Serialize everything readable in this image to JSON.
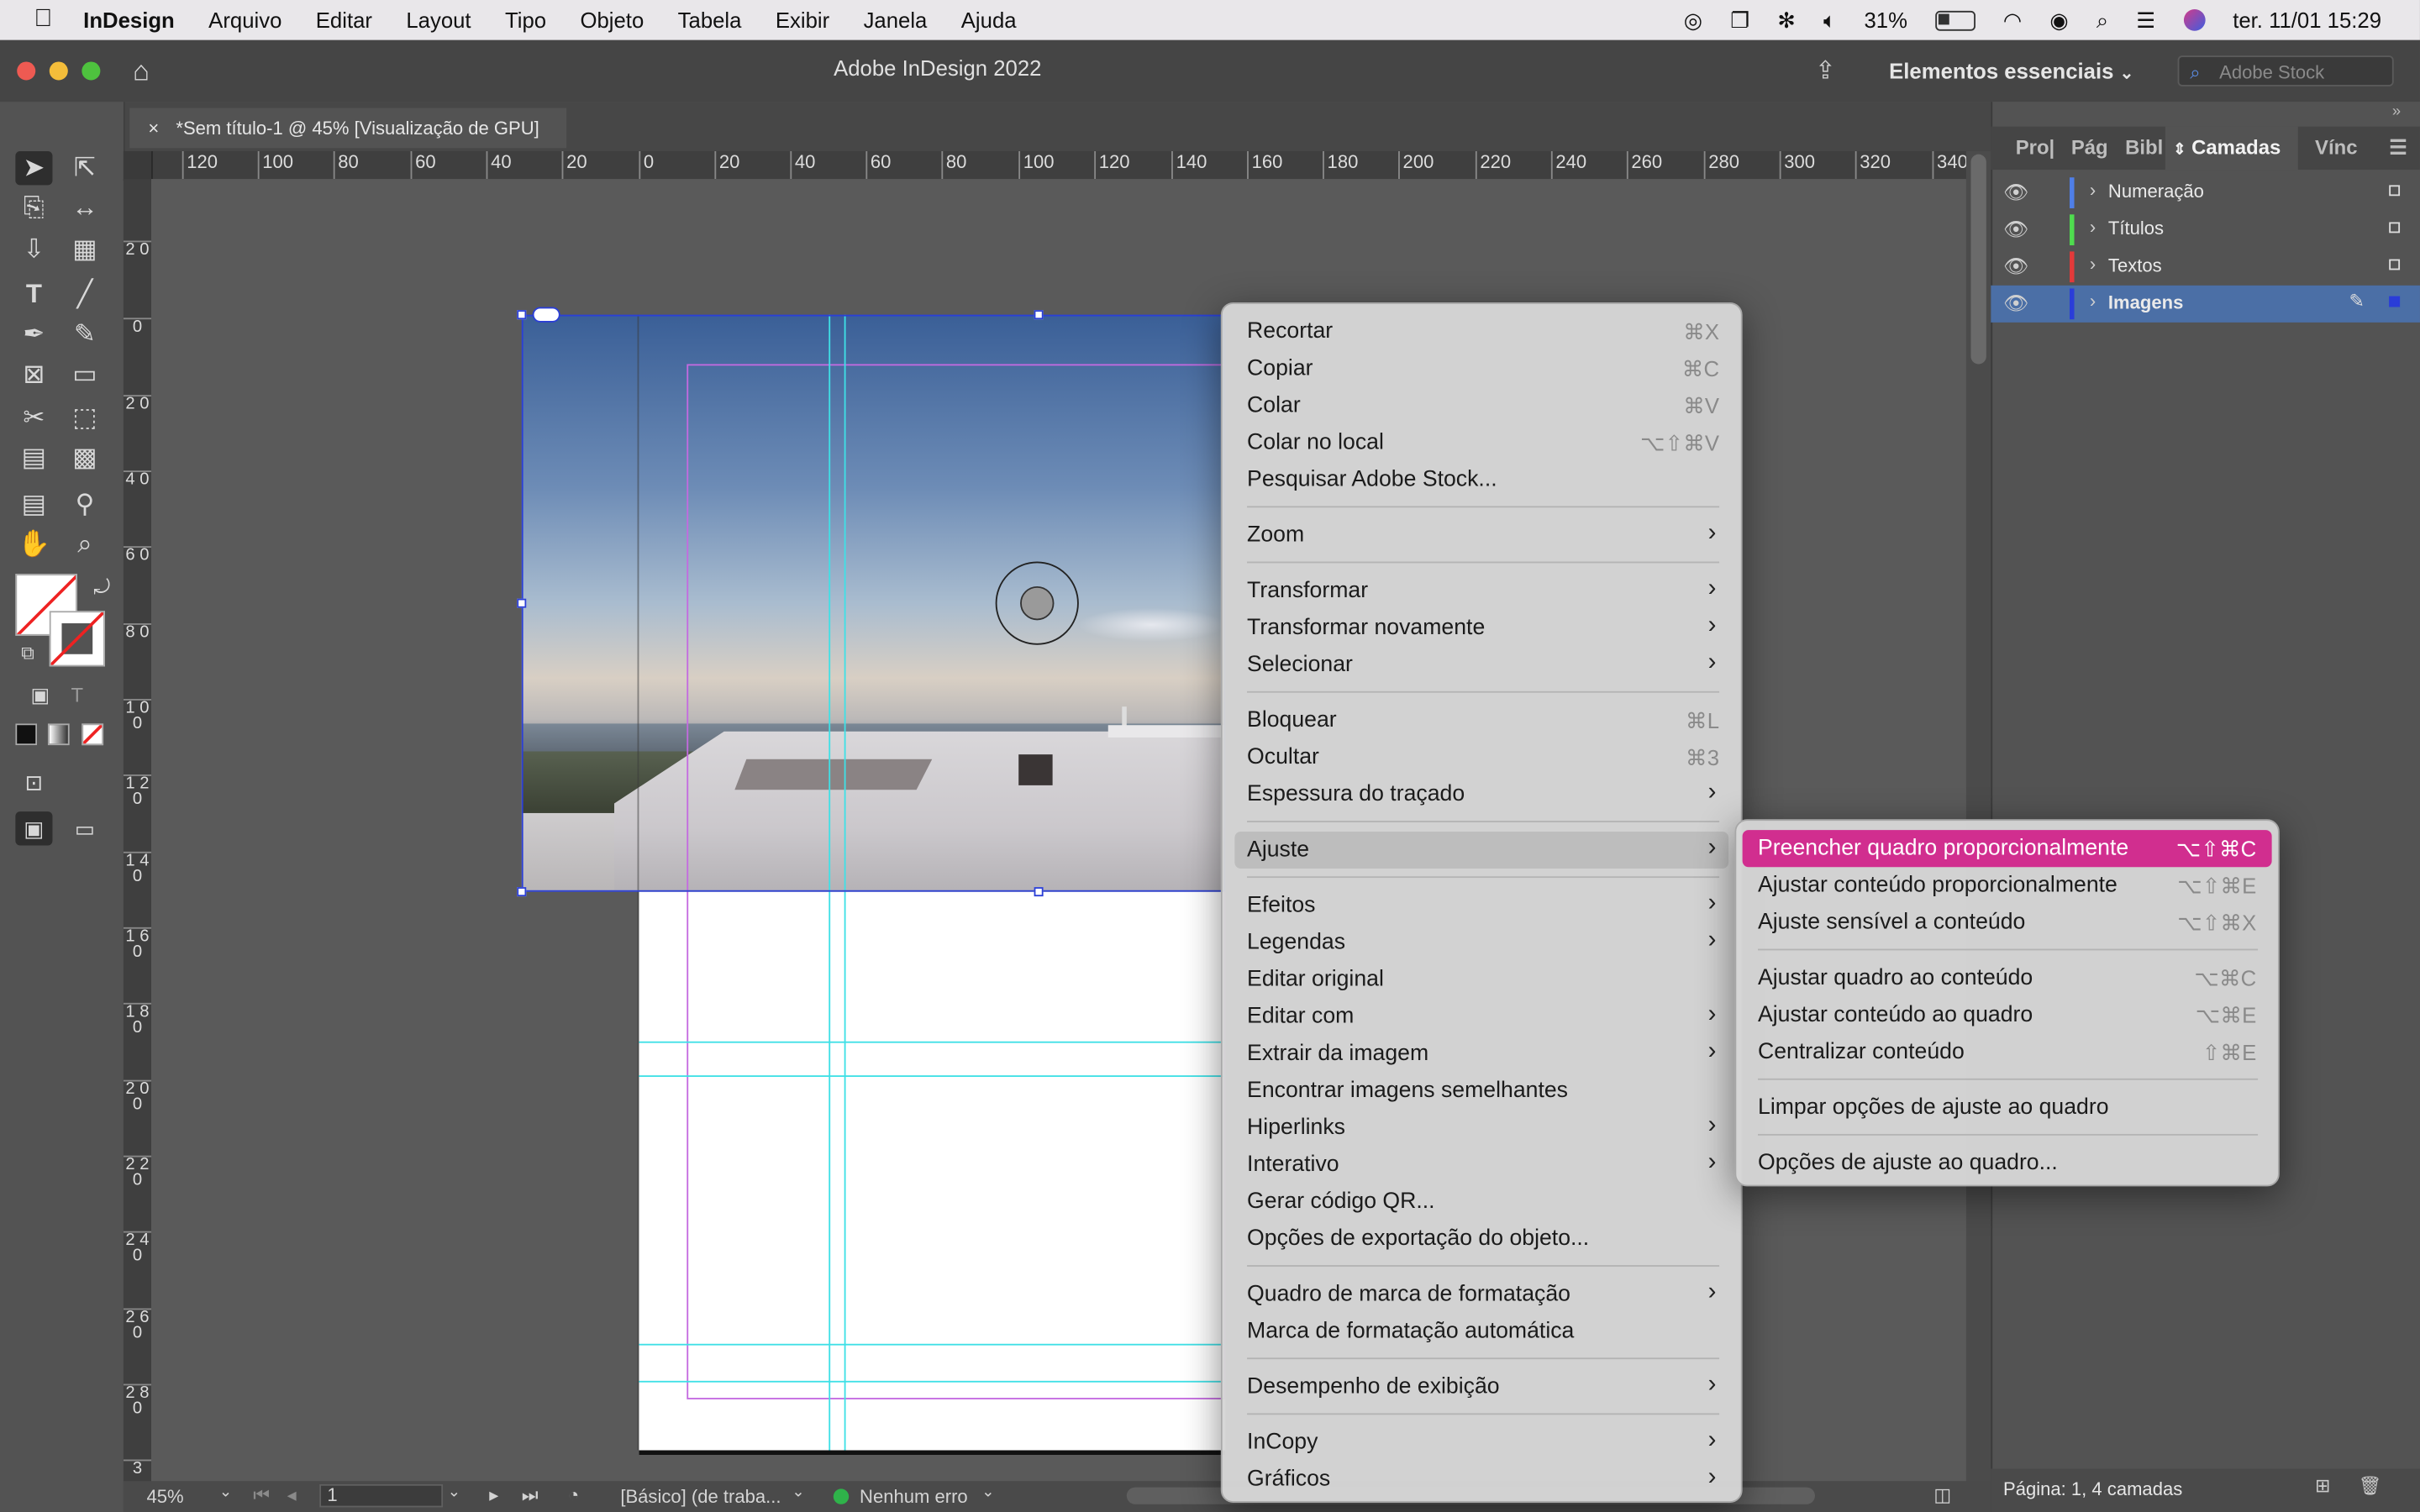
{
  "menubar": {
    "apple_icon": "apple-logo-icon",
    "app_name": "InDesign",
    "items": [
      "Arquivo",
      "Editar",
      "Layout",
      "Tipo",
      "Objeto",
      "Tabela",
      "Exibir",
      "Janela",
      "Ajuda"
    ],
    "battery": "31%",
    "datetime": "ter. 11/01  15:29"
  },
  "window": {
    "title": "Adobe InDesign 2022",
    "workspace": "Elementos essenciais",
    "stock_placeholder": "Adobe Stock"
  },
  "document_tab": {
    "close": "×",
    "label": "*Sem título-1 @ 45% [Visualização de GPU]"
  },
  "ruler": {
    "horizontal": [
      "120",
      "100",
      "80",
      "60",
      "40",
      "20",
      "0",
      "20",
      "40",
      "60",
      "80",
      "100",
      "120",
      "140",
      "160",
      "180",
      "200",
      "220",
      "240",
      "260",
      "280",
      "300",
      "320",
      "340"
    ],
    "vertical": [
      "2 0",
      "0",
      "2 0",
      "4 0",
      "6 0",
      "8 0",
      "1 0 0",
      "1 2 0",
      "1 4 0",
      "1 6 0",
      "1 8 0",
      "2 0 0",
      "2 2 0",
      "2 4 0",
      "2 6 0",
      "2 8 0",
      "3"
    ]
  },
  "context_menu": {
    "items": [
      {
        "label": "Recortar",
        "shortcut": "⌘X"
      },
      {
        "label": "Copiar",
        "shortcut": "⌘C"
      },
      {
        "label": "Colar",
        "shortcut": "⌘V"
      },
      {
        "label": "Colar no local",
        "shortcut": "⌥⇧⌘V"
      },
      {
        "label": "Pesquisar Adobe Stock...",
        "shortcut": ""
      },
      {
        "label": "Zoom",
        "shortcut": ""
      },
      {
        "label": "Transformar",
        "shortcut": ""
      },
      {
        "label": "Transformar novamente",
        "shortcut": ""
      },
      {
        "label": "Selecionar",
        "shortcut": ""
      },
      {
        "label": "Bloquear",
        "shortcut": "⌘L"
      },
      {
        "label": "Ocultar",
        "shortcut": "⌘3"
      },
      {
        "label": "Espessura do traçado",
        "shortcut": ""
      },
      {
        "label": "Ajuste",
        "shortcut": ""
      },
      {
        "label": "Efeitos",
        "shortcut": ""
      },
      {
        "label": "Legendas",
        "shortcut": ""
      },
      {
        "label": "Editar original",
        "shortcut": ""
      },
      {
        "label": "Editar com",
        "shortcut": ""
      },
      {
        "label": "Extrair da imagem",
        "shortcut": ""
      },
      {
        "label": "Encontrar imagens semelhantes",
        "shortcut": ""
      },
      {
        "label": "Hiperlinks",
        "shortcut": ""
      },
      {
        "label": "Interativo",
        "shortcut": ""
      },
      {
        "label": "Gerar código QR...",
        "shortcut": ""
      },
      {
        "label": "Opções de exportação do objeto...",
        "shortcut": ""
      },
      {
        "label": "Quadro de marca de formatação",
        "shortcut": ""
      },
      {
        "label": "Marca de formatação automática",
        "shortcut": ""
      },
      {
        "label": "Desempenho de exibição",
        "shortcut": ""
      },
      {
        "label": "InCopy",
        "shortcut": ""
      },
      {
        "label": "Gráficos",
        "shortcut": ""
      }
    ],
    "submenu_arrow": "›"
  },
  "submenu": {
    "items": [
      {
        "label": "Preencher quadro proporcionalmente",
        "shortcut": "⌥⇧⌘C"
      },
      {
        "label": "Ajustar conteúdo proporcionalmente",
        "shortcut": "⌥⇧⌘E"
      },
      {
        "label": "Ajuste sensível a conteúdo",
        "shortcut": "⌥⇧⌘X"
      },
      {
        "label": "Ajustar quadro ao conteúdo",
        "shortcut": "⌥⌘C"
      },
      {
        "label": "Ajustar conteúdo ao quadro",
        "shortcut": "⌥⌘E"
      },
      {
        "label": "Centralizar conteúdo",
        "shortcut": "⇧⌘E"
      },
      {
        "label": "Limpar opções de ajuste ao quadro",
        "shortcut": ""
      },
      {
        "label": "Opções de ajuste ao quadro...",
        "shortcut": ""
      }
    ]
  },
  "panel": {
    "tabs": [
      "Pro|",
      "Pág",
      "Bibl",
      "Camadas",
      "Vínc"
    ],
    "active_tab": "Camadas",
    "layers": [
      {
        "name": "Numeração",
        "color": "#4f7fe8"
      },
      {
        "name": "Títulos",
        "color": "#4fdc4f"
      },
      {
        "name": "Textos",
        "color": "#e23a3a"
      },
      {
        "name": "Imagens",
        "color": "#2a3dd8"
      }
    ],
    "footer": "Página: 1, 4 camadas"
  },
  "statusbar": {
    "zoom": "45%",
    "page": "1",
    "profile": "[Básico] (de traba...",
    "preflight": "Nenhum erro"
  },
  "colors": {
    "accent_highlight": "#d12e8f",
    "selection": "#2b3fd6",
    "guide": "#3fe0e6",
    "margin": "#c46ae0"
  }
}
